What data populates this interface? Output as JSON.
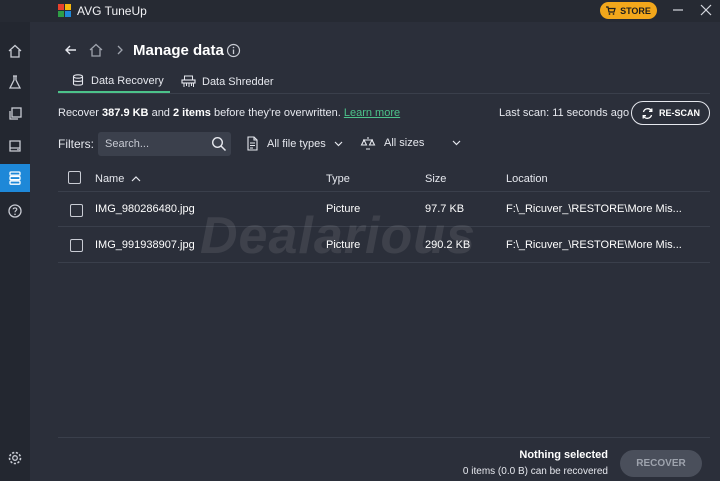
{
  "app": {
    "title": "AVG TuneUp",
    "store_label": "STORE"
  },
  "colors": {
    "accent": "#1e88d8",
    "tab_underline": "#4cc38a",
    "store": "#f2a71b",
    "link": "#4cc38a"
  },
  "header": {
    "title": "Manage data"
  },
  "tabs": [
    {
      "label": "Data Recovery",
      "active": true,
      "icon": "database-recovery-icon"
    },
    {
      "label": "Data Shredder",
      "active": false,
      "icon": "shredder-icon"
    }
  ],
  "summary": {
    "prefix": "Recover ",
    "size": "387.9 KB",
    "mid": " and ",
    "items": "2 items",
    "suffix": " before they're overwritten. ",
    "link": "Learn more",
    "last_scan_label": "Last scan:",
    "last_scan_value": "11 seconds ago",
    "rescan_label": "RE-SCAN"
  },
  "filters": {
    "label": "Filters:",
    "search_placeholder": "Search...",
    "file_types": "All file types",
    "sizes": "All sizes"
  },
  "table": {
    "columns": [
      "Name",
      "Type",
      "Size",
      "Location"
    ],
    "rows": [
      {
        "name": "IMG_980286480.jpg",
        "type": "Picture",
        "size": "97.7 KB",
        "location": "F:\\_Ricuver_\\RESTORE\\More Mis..."
      },
      {
        "name": "IMG_991938907.jpg",
        "type": "Picture",
        "size": "290.2 KB",
        "location": "F:\\_Ricuver_\\RESTORE\\More Mis..."
      }
    ]
  },
  "watermark": "Dealarious",
  "footer": {
    "status_title": "Nothing selected",
    "status_detail": "0 items (0.0 B) can be recovered",
    "recover_label": "RECOVER"
  }
}
